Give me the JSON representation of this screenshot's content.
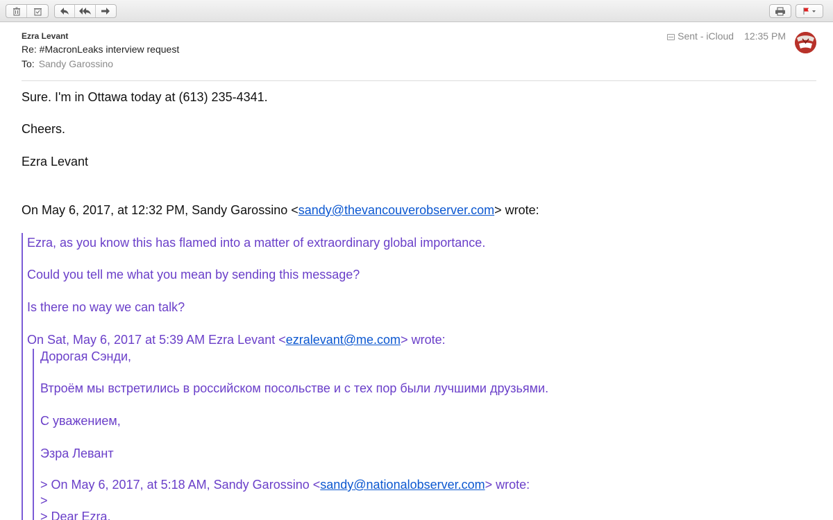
{
  "toolbar": {
    "buttons": [
      "trash-icon",
      "junk-icon",
      "reply-icon",
      "reply-all-icon",
      "forward-icon",
      "print-icon",
      "flag-icon"
    ]
  },
  "header": {
    "from": "Ezra Levant",
    "subject": "Re: #MacronLeaks interview request",
    "to_label": "To:",
    "to_value": "Sandy Garossino",
    "mailbox": "Sent - iCloud",
    "time": "12:35 PM"
  },
  "body": {
    "line1": "Sure. I'm in Ottawa today at (613) 235-4341.",
    "line2": "Cheers.",
    "line3": "Ezra Levant",
    "attribution": {
      "prefix": "On May 6, 2017, at 12:32 PM, Sandy Garossino <",
      "email": "sandy@thevancouverobserver.com",
      "suffix": "> wrote:"
    },
    "quote1": {
      "line1": "Ezra, as you know this has flamed into a matter of extraordinary global importance.",
      "line2": "Could you tell me what you mean by sending this message?",
      "line3": "Is there no way we can talk?",
      "attribution": {
        "prefix": "On Sat, May 6, 2017 at 5:39 AM Ezra Levant <",
        "email": "ezralevant@me.com",
        "suffix": "> wrote:"
      }
    },
    "quote2": {
      "line1": "Дорогая Сэнди,",
      "line2": "Втроём мы встретились в российском посольстве и с тех пор были лучшими друзьями.",
      "line3": "С уважением,",
      "line4": "Эзра Левант",
      "attribution": {
        "prefix": "> On May 6, 2017, at 5:18 AM, Sandy Garossino <",
        "email": "sandy@nationalobserver.com",
        "suffix": "> wrote:"
      },
      "line5": ">",
      "line6": "> Dear Ezra,"
    }
  },
  "colors": {
    "quote_text": "#6a3fc9",
    "link": "#0b57d0",
    "quote_bar": "#7b5bd6"
  }
}
